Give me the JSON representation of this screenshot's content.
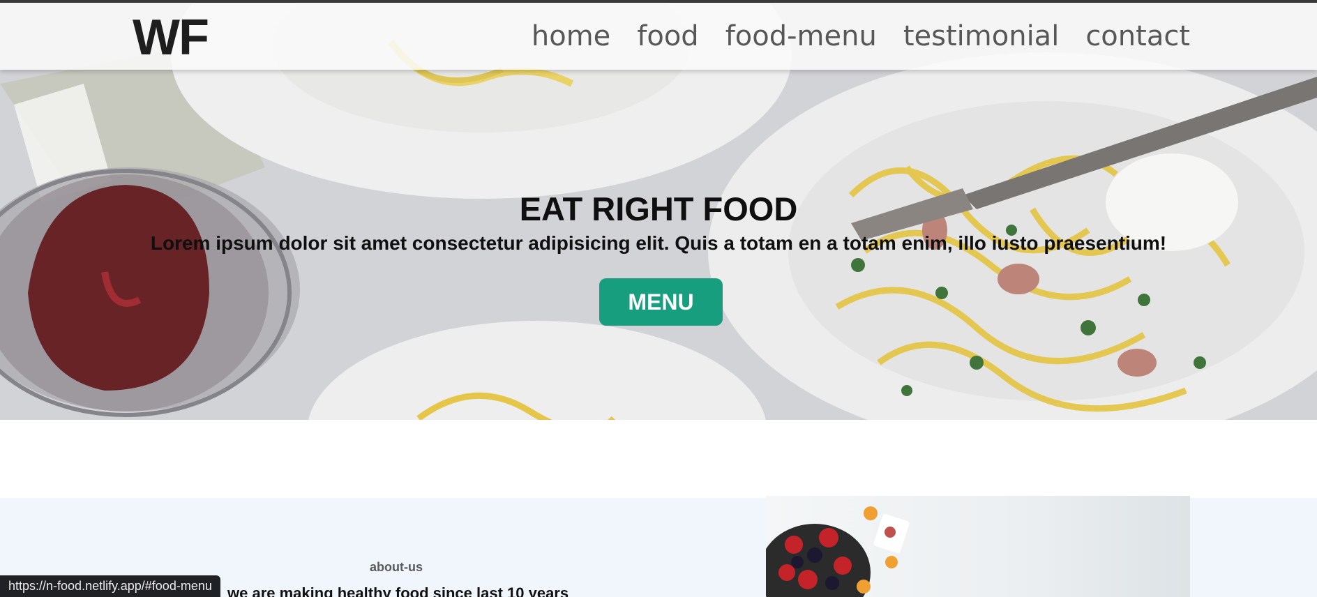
{
  "brand": {
    "logo": "WF"
  },
  "nav": {
    "items": [
      {
        "label": "home"
      },
      {
        "label": "food"
      },
      {
        "label": "food-menu"
      },
      {
        "label": "testimonial"
      },
      {
        "label": "contact"
      }
    ]
  },
  "hero": {
    "title": "EAT RIGHT FOOD",
    "subtitle": "Lorem ipsum dolor sit amet consectetur adipisicing elit. Quis a totam en a totam enim, illo iusto praesentium!",
    "button_label": "MENU",
    "button_color": "#169e7e"
  },
  "about": {
    "tag": "about-us",
    "heading": "we are making healthy food since last 10 years"
  },
  "status_bar": {
    "url": "https://n-food.netlify.app/#food-menu"
  }
}
